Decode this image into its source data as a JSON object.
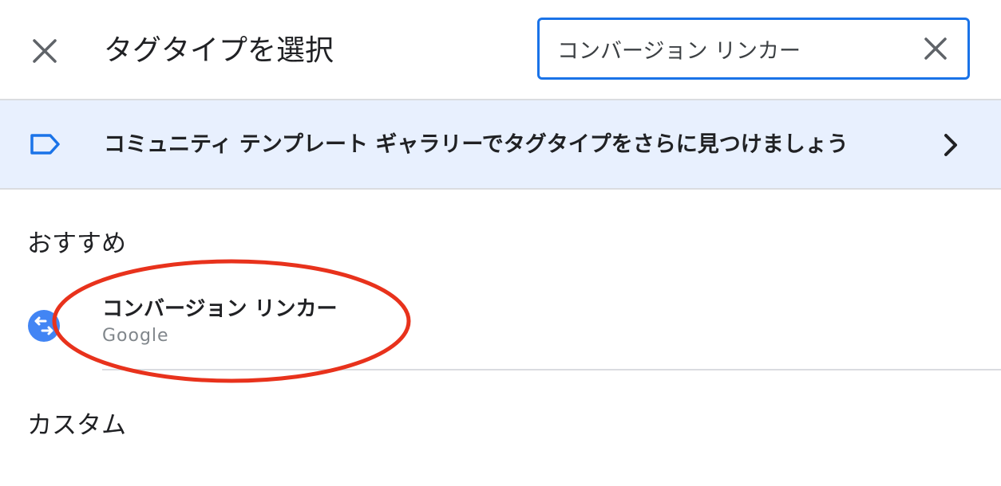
{
  "dialog": {
    "title": "タグタイプを選択",
    "close_icon": "close-icon"
  },
  "search": {
    "value": "コンバージョン リンカー",
    "clear_icon": "close-icon"
  },
  "banner": {
    "icon": "label-icon",
    "text": "コミュニティ テンプレート ギャラリーでタグタイプをさらに見つけましょう",
    "chevron_icon": "chevron-right-icon"
  },
  "sections": {
    "recommended": {
      "title": "おすすめ",
      "items": [
        {
          "name": "コンバージョン リンカー",
          "vendor": "Google",
          "icon": "conversion-linker-icon"
        }
      ]
    },
    "custom": {
      "title": "カスタム"
    }
  },
  "colors": {
    "accent": "#1a73e8",
    "banner_bg": "#e8f0fe",
    "icon_blue": "#4285f4",
    "annotation_red": "#e8321c",
    "text_primary": "#202124",
    "text_secondary": "#80868b",
    "divider": "#dadce0"
  }
}
